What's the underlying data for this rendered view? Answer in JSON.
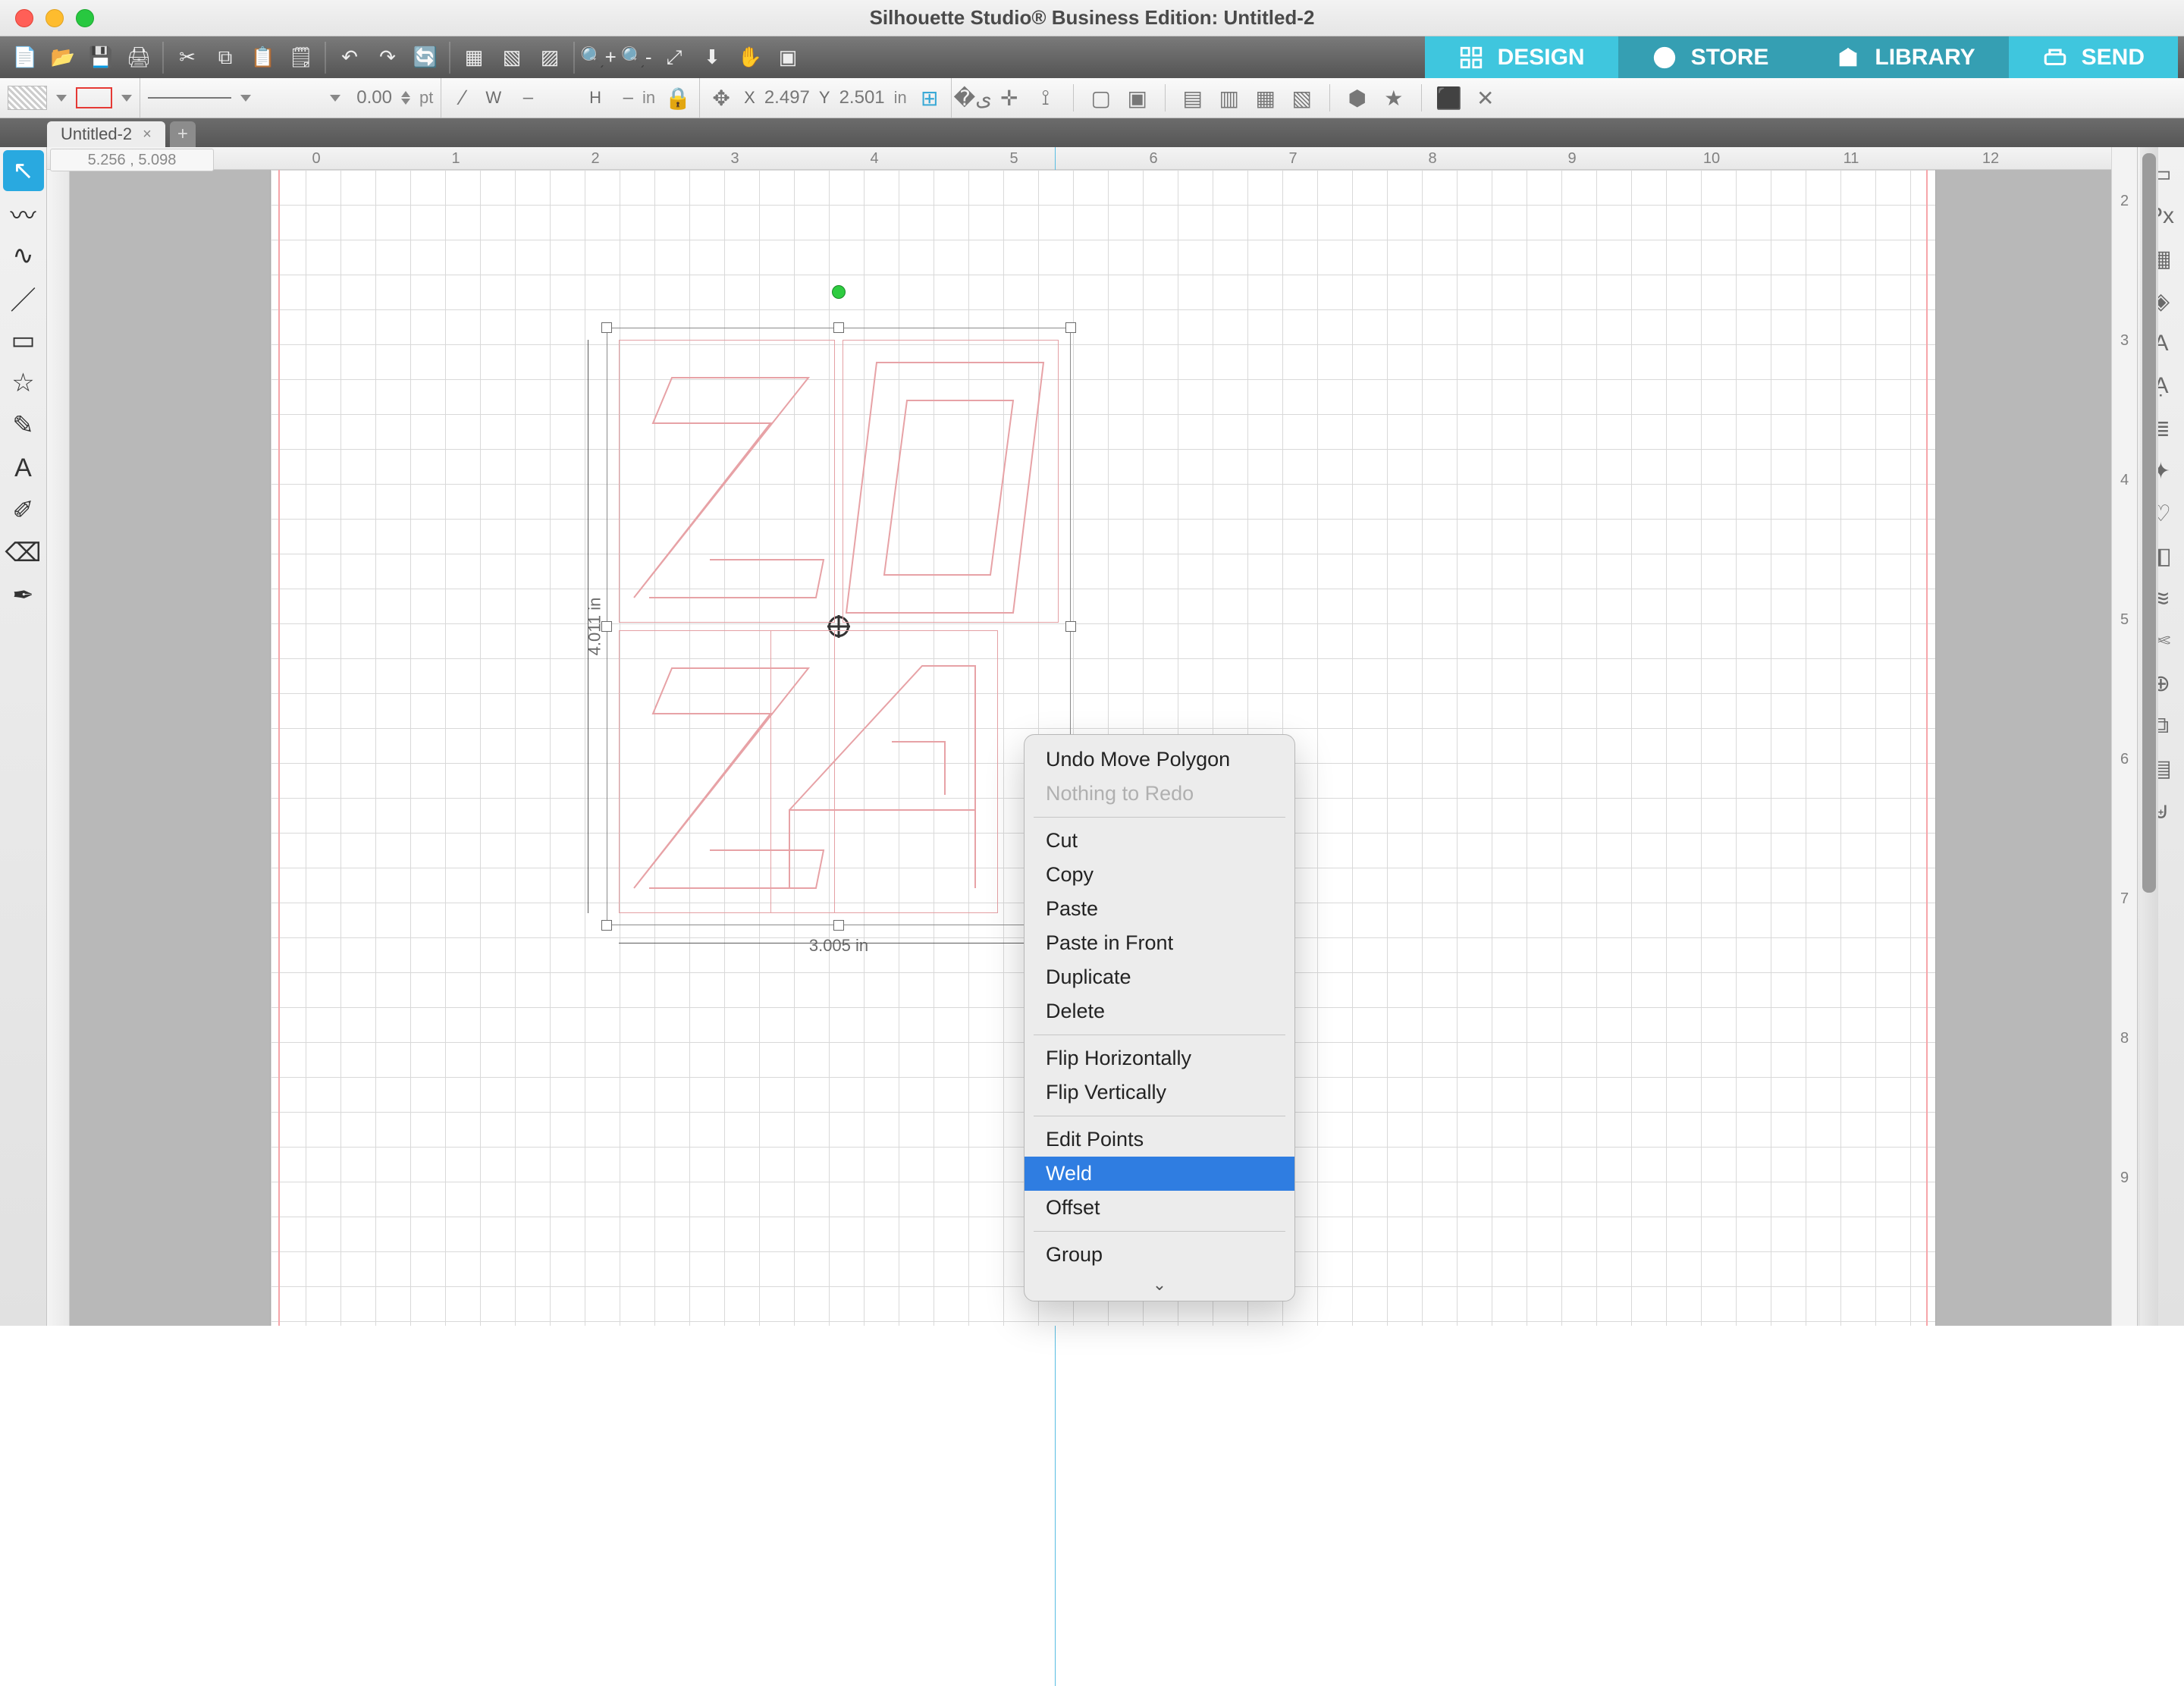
{
  "app": {
    "title": "Silhouette Studio® Business Edition: Untitled-2"
  },
  "top_tabs": {
    "design": "DESIGN",
    "store": "STORE",
    "library": "LIBRARY",
    "send": "SEND"
  },
  "doc_tab": {
    "name": "Untitled-2"
  },
  "props": {
    "line_weight_value": "0.00",
    "line_weight_unit": "pt",
    "w_label": "W",
    "w_value": "–",
    "h_label": "H",
    "h_value": "–",
    "wh_unit": "in",
    "x_label": "X",
    "x_value": "2.497",
    "y_label": "Y",
    "y_value": "2.501",
    "xy_unit": "in"
  },
  "cursor_coords": "5.256 , 5.098",
  "ruler_h": [
    "0",
    "1",
    "2",
    "3",
    "4",
    "5",
    "6",
    "7",
    "8",
    "9",
    "10",
    "11",
    "12"
  ],
  "ruler_v_tabs": [
    "2",
    "3",
    "4",
    "5",
    "6",
    "7",
    "8",
    "9"
  ],
  "dims": {
    "width_text": "3.005 in",
    "height_text": "4.011 in"
  },
  "context_menu": {
    "items": [
      {
        "label": "Undo Move Polygon",
        "kind": "item"
      },
      {
        "label": "Nothing to Redo",
        "kind": "disabled"
      },
      {
        "kind": "sep"
      },
      {
        "label": "Cut",
        "kind": "item"
      },
      {
        "label": "Copy",
        "kind": "item"
      },
      {
        "label": "Paste",
        "kind": "item"
      },
      {
        "label": "Paste in Front",
        "kind": "item"
      },
      {
        "label": "Duplicate",
        "kind": "item"
      },
      {
        "label": "Delete",
        "kind": "item"
      },
      {
        "kind": "sep"
      },
      {
        "label": "Flip Horizontally",
        "kind": "item"
      },
      {
        "label": "Flip Vertically",
        "kind": "item"
      },
      {
        "kind": "sep"
      },
      {
        "label": "Edit Points",
        "kind": "item"
      },
      {
        "label": "Weld",
        "kind": "highlight"
      },
      {
        "label": "Offset",
        "kind": "item"
      },
      {
        "kind": "sep"
      },
      {
        "label": "Group",
        "kind": "item"
      }
    ]
  },
  "left_tools": [
    "select",
    "edit-points",
    "freehand",
    "line",
    "rectangle",
    "star",
    "pencil",
    "text",
    "note",
    "eraser",
    "eyedropper"
  ],
  "right_tools": [
    "page-setup",
    "pixscan",
    "grid",
    "registration",
    "text-style",
    "text-style-2",
    "layers",
    "trace",
    "send-panel",
    "fill",
    "line-style",
    "cut",
    "modify",
    "replicate",
    "nest",
    "weld-panel"
  ],
  "toolbar_icons": [
    "new",
    "open",
    "save",
    "print",
    "sep",
    "cut",
    "copy",
    "paste",
    "clipboard",
    "sep",
    "undo",
    "redo",
    "refresh",
    "sep",
    "select-all",
    "deselect",
    "invert",
    "sep",
    "zoom-in",
    "zoom-out",
    "fit",
    "download",
    "pan",
    "center-canvas"
  ],
  "align_icons": [
    "align-left",
    "align-center",
    "align-right",
    "sep",
    "crop",
    "crop2",
    "sep",
    "front",
    "forward",
    "backward",
    "back",
    "sep",
    "group",
    "star-fav",
    "sep",
    "3d",
    "delete-x"
  ]
}
